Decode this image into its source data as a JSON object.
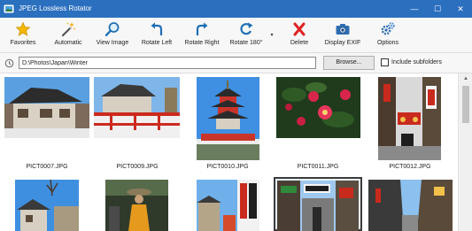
{
  "window": {
    "title": "JPEG Lossless Rotator",
    "minimize_glyph": "—",
    "maximize_glyph": "☐",
    "close_glyph": "✕"
  },
  "toolbar": {
    "favorites": {
      "label": "Favorites",
      "icon": "star-icon"
    },
    "automatic": {
      "label": "Automatic",
      "icon": "magic-wand-icon"
    },
    "view_image": {
      "label": "View Image",
      "icon": "magnifier-icon"
    },
    "rotate_left": {
      "label": "Rotate Left",
      "icon": "rotate-left-icon"
    },
    "rotate_right": {
      "label": "Rotate Right",
      "icon": "rotate-right-icon"
    },
    "rotate_180": {
      "label": "Rotate 180°",
      "icon": "rotate-180-icon"
    },
    "rotate_180_dropdown_glyph": "▾",
    "delete": {
      "label": "Delete",
      "icon": "delete-x-icon"
    },
    "save_exif": {
      "label": "Display EXIF",
      "icon": "camera-icon"
    },
    "options": {
      "label": "Options",
      "icon": "gears-icon"
    }
  },
  "pathbar": {
    "path": "D:\\Photos\\Japan\\Winter",
    "browse_label": "Browse...",
    "include_subfolders_label": "Include subfolders",
    "include_subfolders_checked": false
  },
  "thumbnails": [
    {
      "filename": "PICT0007.JPG",
      "subject": "japanese-house-photo"
    },
    {
      "filename": "PICT0009.JPG",
      "subject": "temple-red-fence-photo"
    },
    {
      "filename": "PICT0010.JPG",
      "subject": "pagoda-photo"
    },
    {
      "filename": "PICT0011.JPG",
      "subject": "camellia-flowers-photo"
    },
    {
      "filename": "PICT0012.JPG",
      "subject": "street-lanterns-photo"
    },
    {
      "filename": "",
      "subject": "snowy-tree-house-photo"
    },
    {
      "filename": "",
      "subject": "monk-statue-photo"
    },
    {
      "filename": "",
      "subject": "shop-signs-photo"
    },
    {
      "filename": "",
      "subject": "street-signs-photo",
      "selected": true
    },
    {
      "filename": "",
      "subject": "narrow-street-photo"
    }
  ],
  "colors": {
    "titlebar": "#2b6fbf",
    "selection_background": "#e5f1fb"
  }
}
